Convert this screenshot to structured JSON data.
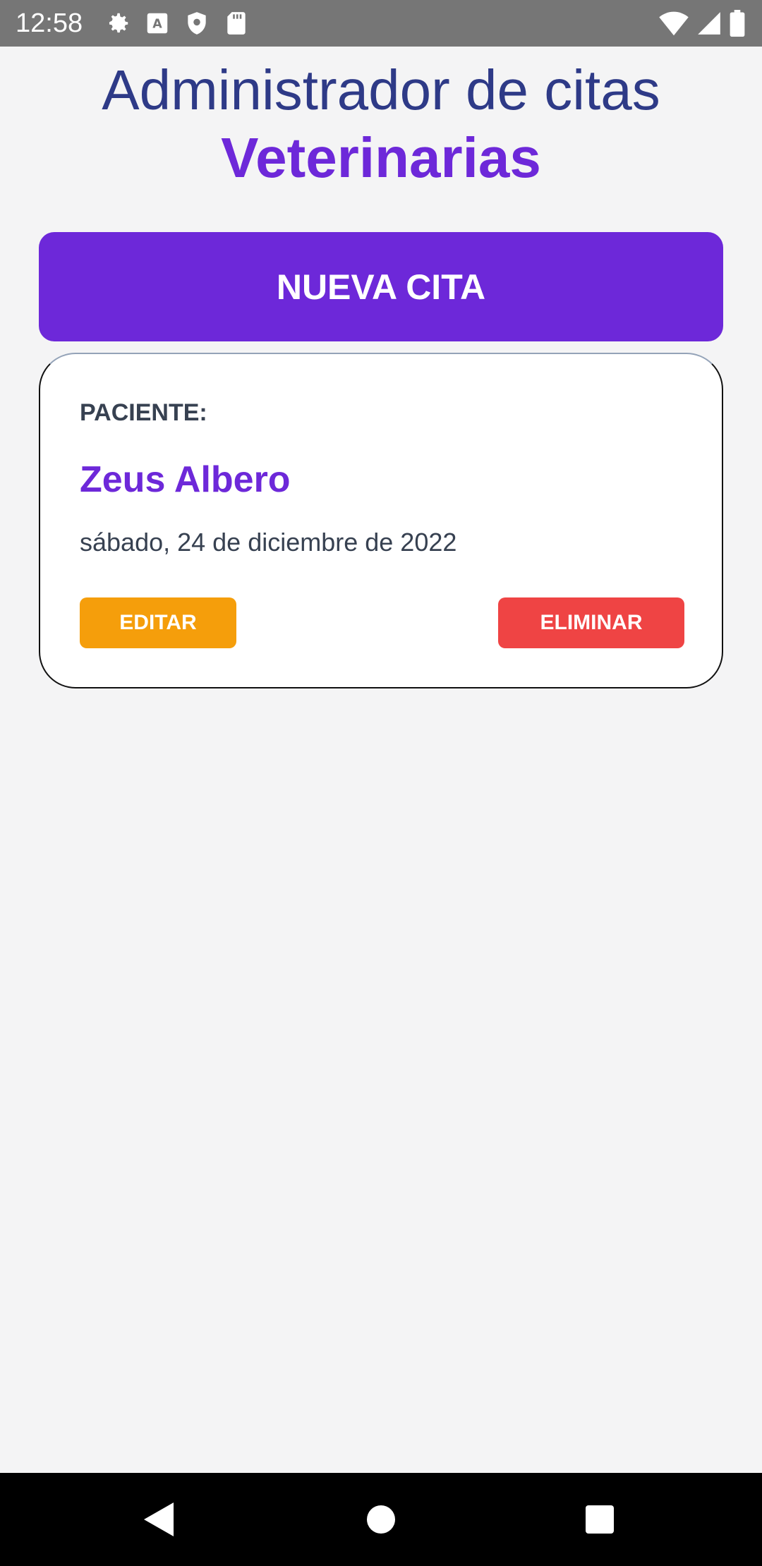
{
  "status_bar": {
    "time": "12:58",
    "icons": [
      "gear-icon",
      "keyboard-a-icon",
      "shield-icon",
      "sd-card-icon",
      "wifi-icon",
      "signal-icon",
      "battery-icon"
    ]
  },
  "header": {
    "title_line1": "Administrador de citas",
    "title_line2": "Veterinarias"
  },
  "actions": {
    "new_appointment_label": "NUEVA CITA"
  },
  "appointments": [
    {
      "patient_label": "PACIENTE:",
      "patient_name": "Zeus Albero",
      "date": "sábado, 24 de diciembre de 2022",
      "edit_label": "EDITAR",
      "delete_label": "ELIMINAR"
    }
  ],
  "colors": {
    "primary": "#6d28d9",
    "title_dark": "#2e3a87",
    "edit": "#f59e0b",
    "delete": "#ef4444",
    "background": "#f4f4f5"
  },
  "nav_bar": {
    "icons": [
      "back-icon",
      "home-icon",
      "recents-icon"
    ]
  }
}
